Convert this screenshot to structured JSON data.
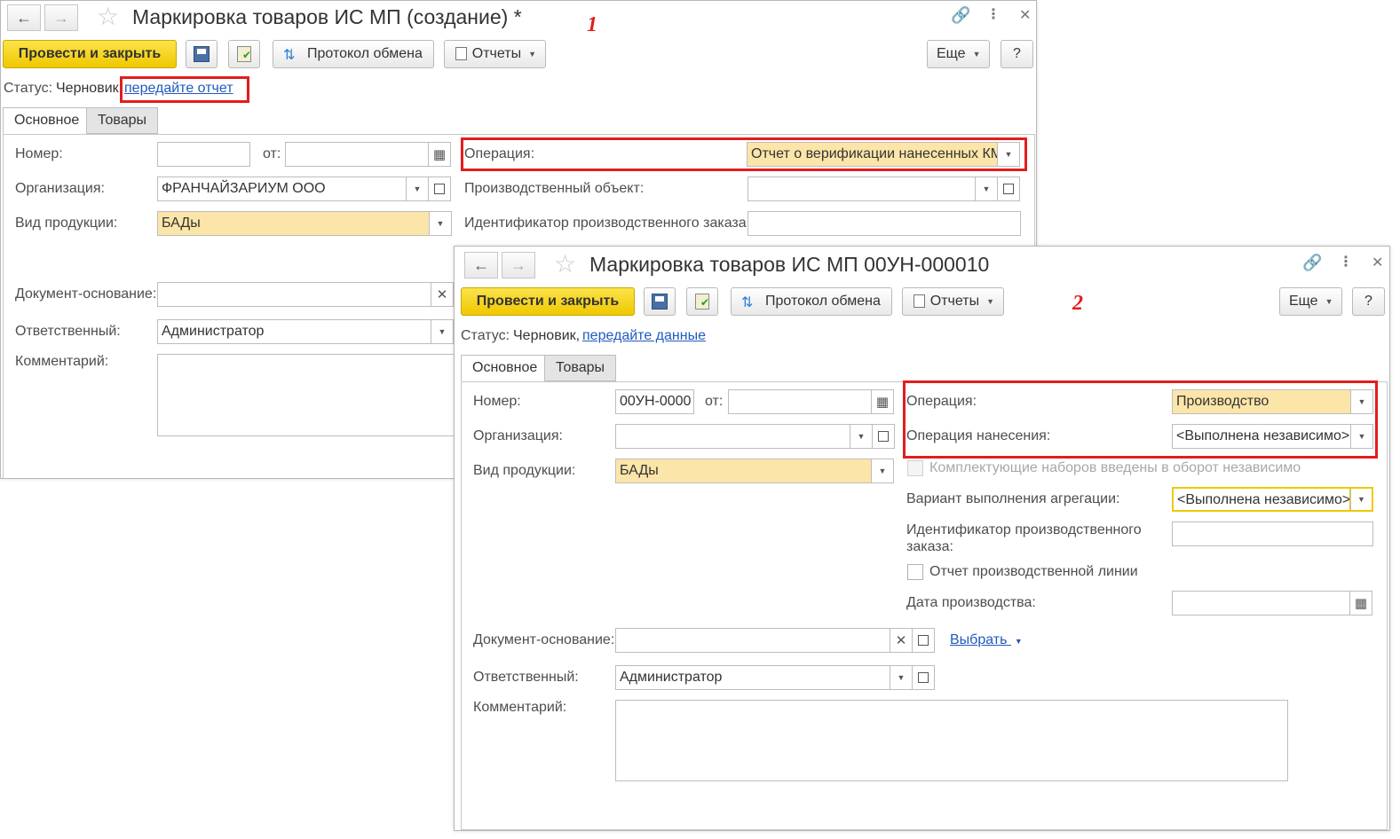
{
  "window1": {
    "title": "Маркировка товаров ИС МП (создание) *",
    "marker": "1",
    "toolbar": {
      "post_close": "Провести и закрыть",
      "exchange_protocol": "Протокол обмена",
      "reports": "Отчеты",
      "more": "Еще",
      "help": "?"
    },
    "status_label": "Статус:",
    "status_value": "Черновик,",
    "status_link": "передайте отчет",
    "tabs": [
      "Основное",
      "Товары"
    ],
    "fields": {
      "number_label": "Номер:",
      "number_value": "",
      "from_label": "от:",
      "from_value": "",
      "org_label": "Организация:",
      "org_value": "ФРАНЧАЙЗАРИУМ ООО",
      "product_kind_label": "Вид продукции:",
      "product_kind_value": "БАДы",
      "base_doc_label": "Документ-основание:",
      "base_doc_value": "",
      "responsible_label": "Ответственный:",
      "responsible_value": "Администратор",
      "comment_label": "Комментарий:",
      "operation_label": "Операция:",
      "operation_value": "Отчет о верификации нанесенных КМ",
      "prod_object_label": "Производственный объект:",
      "prod_object_value": "",
      "prod_order_id_label": "Идентификатор производственного заказа:",
      "prod_order_id_value": ""
    }
  },
  "window2": {
    "title": "Маркировка товаров ИС МП 00УН-000010",
    "marker": "2",
    "toolbar": {
      "post_close": "Провести и закрыть",
      "exchange_protocol": "Протокол обмена",
      "reports": "Отчеты",
      "more": "Еще",
      "help": "?"
    },
    "status_label": "Статус:",
    "status_value": "Черновик,",
    "status_link": "передайте данные",
    "tabs": [
      "Основное",
      "Товары"
    ],
    "fields": {
      "number_label": "Номер:",
      "number_value": "00УН-0000",
      "from_label": "от:",
      "from_value": "",
      "org_label": "Организация:",
      "org_value": "",
      "product_kind_label": "Вид продукции:",
      "product_kind_value": "БАДы",
      "operation_label": "Операция:",
      "operation_value": "Производство",
      "apply_op_label": "Операция нанесения:",
      "apply_op_value": "<Выполнена независимо>",
      "kits_label": "Комплектующие наборов введены в оборот независимо",
      "aggregation_label": "Вариант выполнения агрегации:",
      "aggregation_value": "<Выполнена независимо>",
      "prod_order_id_label": "Идентификатор производственного заказа:",
      "prod_order_id_value": "",
      "line_report_label": "Отчет производственной линии",
      "prod_date_label": "Дата производства:",
      "prod_date_value": "",
      "base_doc_label": "Документ-основание:",
      "base_doc_value": "",
      "choose_link": "Выбрать",
      "responsible_label": "Ответственный:",
      "responsible_value": "Администратор",
      "comment_label": "Комментарий:"
    }
  },
  "colors": {
    "accent_yellow": "#f5d21a",
    "field_yellow": "#fbe5a8",
    "highlight_red": "#e21d1d",
    "link_blue": "#1f5bbd"
  }
}
